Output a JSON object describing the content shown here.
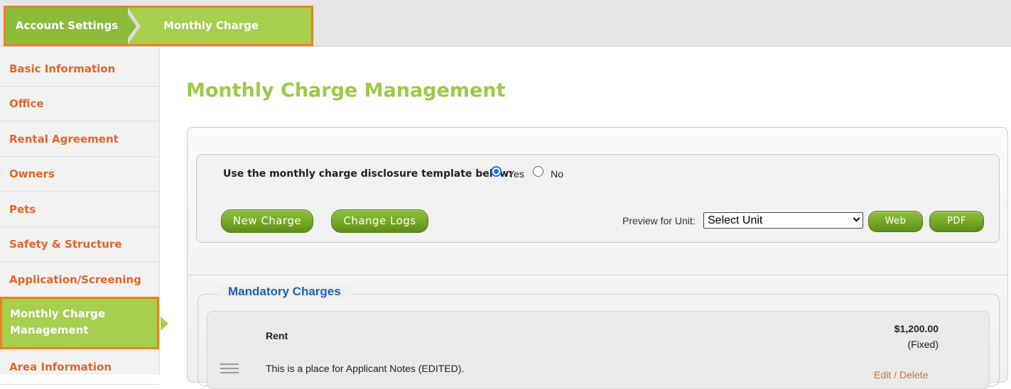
{
  "breadcrumb": {
    "items": [
      "Account Settings",
      "Monthly Charge"
    ]
  },
  "sidebar": {
    "items": [
      {
        "label": "Basic Information"
      },
      {
        "label": "Office"
      },
      {
        "label": "Rental Agreement"
      },
      {
        "label": "Owners"
      },
      {
        "label": "Pets"
      },
      {
        "label": "Safety & Structure"
      },
      {
        "label": "Application/Screening"
      },
      {
        "label": "Monthly Charge Management",
        "active": true
      },
      {
        "label": "Area Information"
      }
    ]
  },
  "main": {
    "title": "Monthly Charge Management",
    "template_question": "Use the monthly charge disclosure template below:",
    "radio_yes": "Yes",
    "radio_no": "No",
    "selected": "Yes",
    "buttons": {
      "new_charge": "New Charge",
      "change_logs": "Change Logs",
      "web": "Web",
      "pdf": "PDF"
    },
    "preview_label": "Preview for Unit:",
    "unit_select": "Select Unit"
  },
  "mandatory": {
    "legend": "Mandatory Charges",
    "charges": [
      {
        "name": "Rent",
        "amount": "$1,200.00",
        "type": "(Fixed)",
        "notes": "This is a place for Applicant Notes (EDITED).",
        "edit": "Edit",
        "separator": "/",
        "delete": "Delete"
      }
    ]
  },
  "colors": {
    "accent_green": "#a5cf4c",
    "highlight_orange": "#f07f22",
    "link_orange": "#e3652a",
    "legend_blue": "#1d5fb4"
  }
}
